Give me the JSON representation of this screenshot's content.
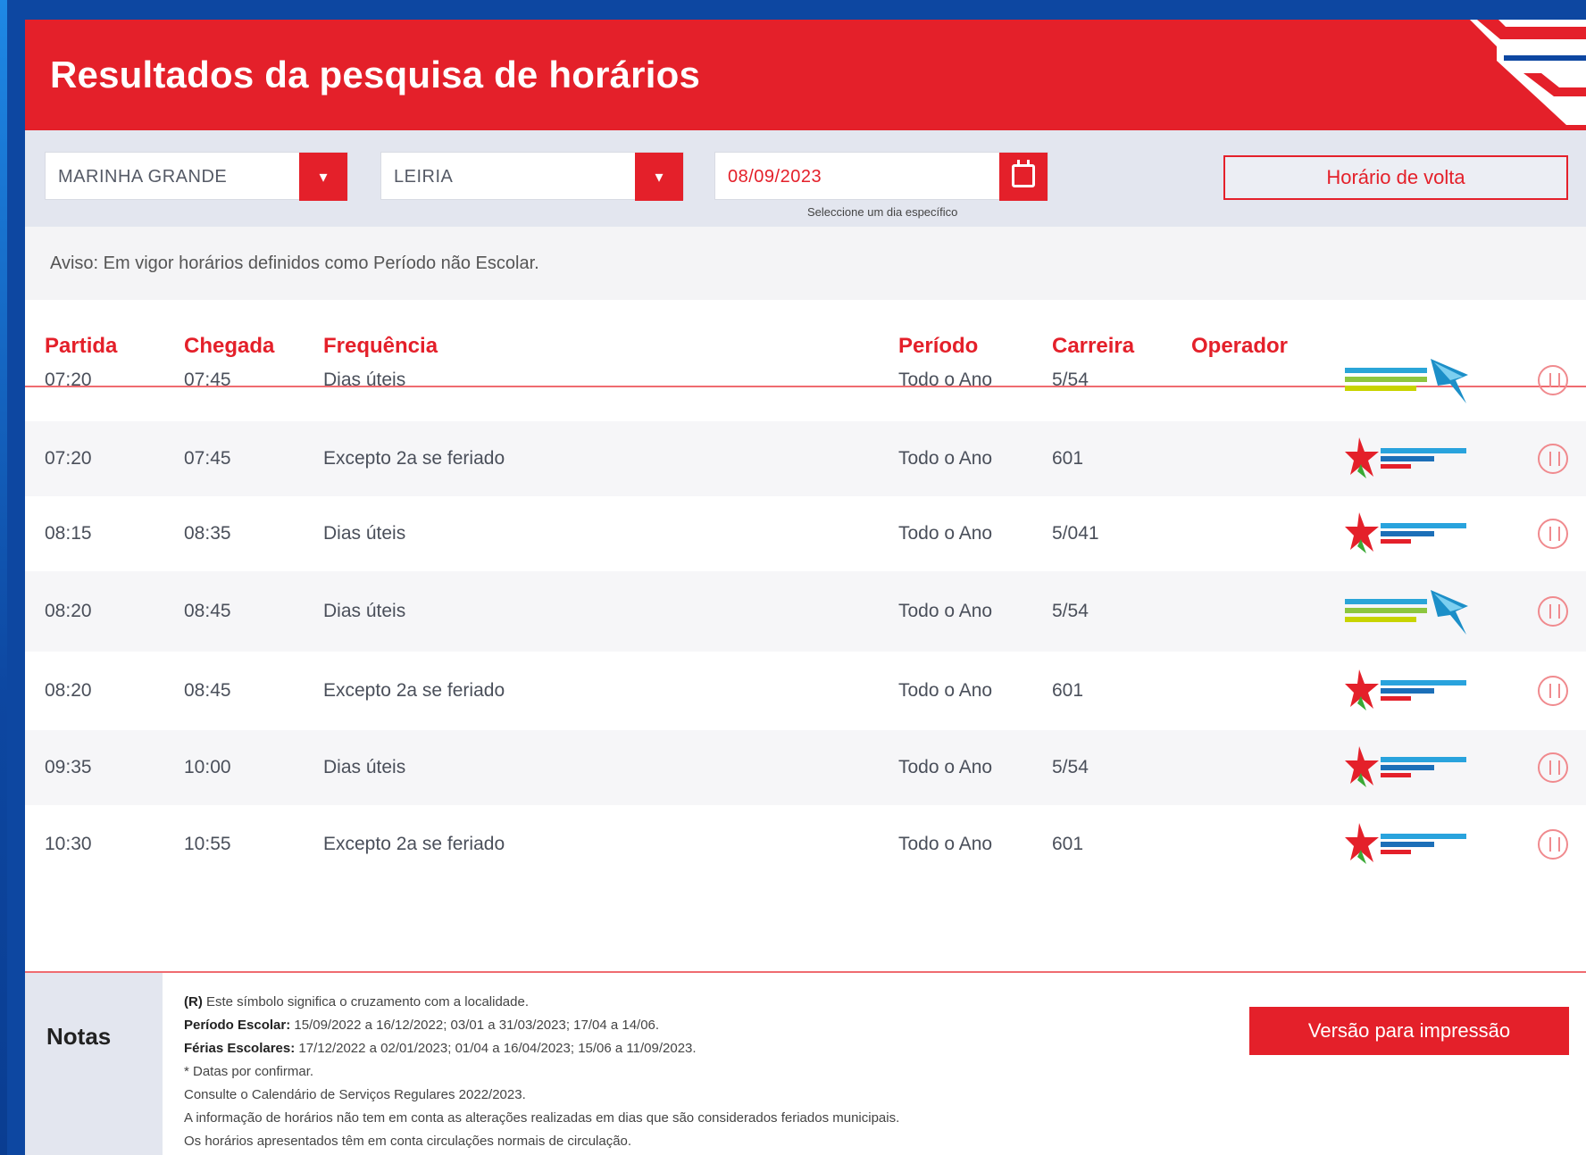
{
  "header": {
    "title": "Resultados da pesquisa de horários"
  },
  "search": {
    "origin": "MARINHA GRANDE",
    "destination": "LEIRIA",
    "date": "08/09/2023",
    "date_hint": "Seleccione um dia específico",
    "return_button": "Horário de volta"
  },
  "notice": "Aviso: Em vigor horários definidos como Período não Escolar.",
  "columns": {
    "departure": "Partida",
    "arrival": "Chegada",
    "frequency": "Frequência",
    "period": "Período",
    "route": "Carreira",
    "operator": "Operador"
  },
  "rows": [
    {
      "departure": "07:20",
      "arrival": "07:45",
      "frequency": "Dias úteis",
      "period": "Todo o Ano",
      "route": "5/54",
      "operator": "rodoviaria-do-oeste"
    },
    {
      "departure": "07:20",
      "arrival": "07:45",
      "frequency": "Excepto 2a se feriado",
      "period": "Todo o Ano",
      "route": "601",
      "operator": "rodoviaria-do-tejo"
    },
    {
      "departure": "08:15",
      "arrival": "08:35",
      "frequency": "Dias úteis",
      "period": "Todo o Ano",
      "route": "5/041",
      "operator": "rodoviaria-do-tejo"
    },
    {
      "departure": "08:20",
      "arrival": "08:45",
      "frequency": "Dias úteis",
      "period": "Todo o Ano",
      "route": "5/54",
      "operator": "rodoviaria-do-oeste"
    },
    {
      "departure": "08:20",
      "arrival": "08:45",
      "frequency": "Excepto 2a se feriado",
      "period": "Todo o Ano",
      "route": "601",
      "operator": "rodoviaria-do-tejo"
    },
    {
      "departure": "09:35",
      "arrival": "10:00",
      "frequency": "Dias úteis",
      "period": "Todo o Ano",
      "route": "5/54",
      "operator": "rodoviaria-do-tejo"
    },
    {
      "departure": "10:30",
      "arrival": "10:55",
      "frequency": "Excepto 2a se feriado",
      "period": "Todo o Ano",
      "route": "601",
      "operator": "rodoviaria-do-tejo"
    }
  ],
  "notes": {
    "label": "Notas",
    "lines": [
      {
        "bold": "(R)",
        "text": " Este símbolo significa o cruzamento com a localidade."
      },
      {
        "bold": "Período Escolar:",
        "text": " 15/09/2022 a 16/12/2022; 03/01 a 31/03/2023; 17/04 a 14/06."
      },
      {
        "bold": "Férias Escolares:",
        "text": " 17/12/2022 a 02/01/2023; 01/04 a 16/04/2023; 15/06 a 11/09/2023."
      },
      {
        "bold": "",
        "text": "* Datas por confirmar."
      },
      {
        "bold": "",
        "text": "Consulte o Calendário de Serviços Regulares 2022/2023."
      },
      {
        "bold": "",
        "text": "A informação de horários não tem em conta as alterações realizadas em dias que são considerados feriados municipais."
      },
      {
        "bold": "",
        "text": "Os horários apresentados têm em conta circulações normais de circulação."
      }
    ],
    "print_button": "Versão para impressão"
  },
  "colors": {
    "brand_red": "#e4202a",
    "frame_blue": "#0d47a1",
    "bar_grey": "#e3e6ef"
  }
}
